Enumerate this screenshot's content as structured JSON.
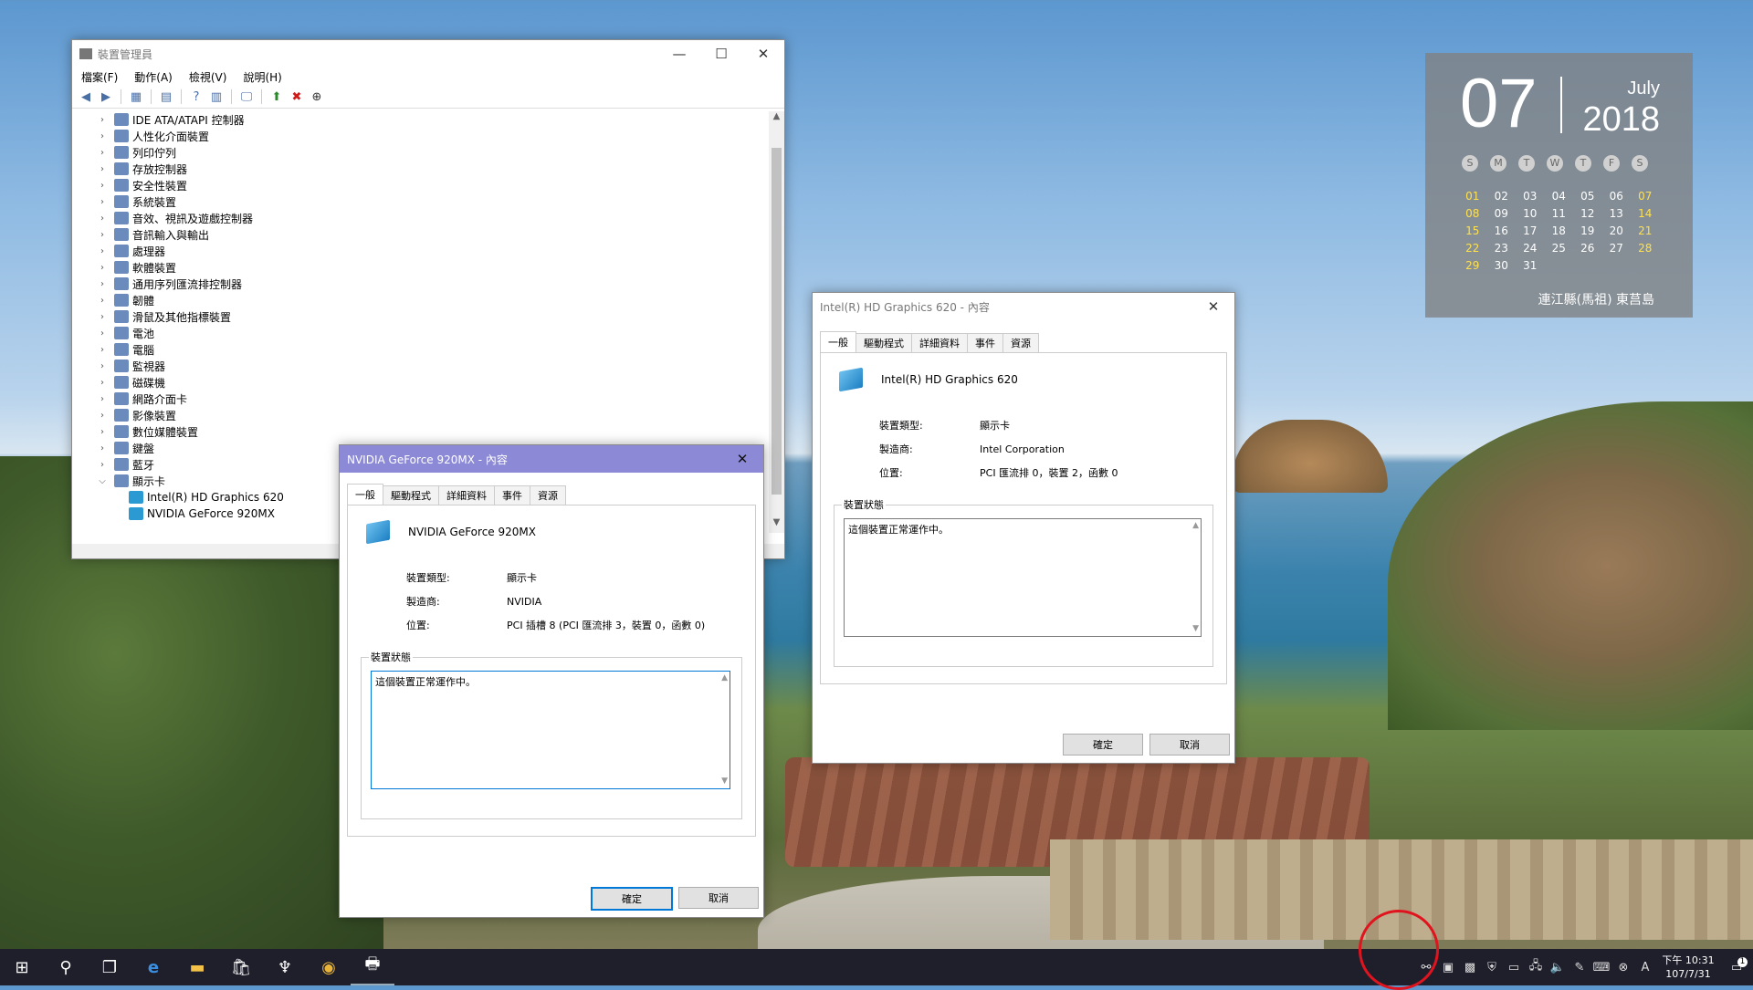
{
  "calendar": {
    "day": "07",
    "month": "July",
    "year": "2018",
    "weekdays": [
      "S",
      "M",
      "T",
      "W",
      "T",
      "F",
      "S"
    ],
    "weeks": [
      [
        "01",
        "02",
        "03",
        "04",
        "05",
        "06",
        "07"
      ],
      [
        "08",
        "09",
        "10",
        "11",
        "12",
        "13",
        "14"
      ],
      [
        "15",
        "16",
        "17",
        "18",
        "19",
        "20",
        "21"
      ],
      [
        "22",
        "23",
        "24",
        "25",
        "26",
        "27",
        "28"
      ],
      [
        "29",
        "30",
        "31",
        "",
        "",
        "",
        ""
      ]
    ],
    "location": "連江縣(馬祖)  東莒島"
  },
  "device_manager": {
    "title": "裝置管理員",
    "menu": [
      "檔案(F)",
      "動作(A)",
      "檢視(V)",
      "說明(H)"
    ],
    "tree": [
      "IDE ATA/ATAPI 控制器",
      "人性化介面裝置",
      "列印佇列",
      "存放控制器",
      "安全性裝置",
      "系統裝置",
      "音效、視訊及遊戲控制器",
      "音訊輸入與輸出",
      "處理器",
      "軟體裝置",
      "通用序列匯流排控制器",
      "韌體",
      "滑鼠及其他指標裝置",
      "電池",
      "電腦",
      "監視器",
      "磁碟機",
      "網路介面卡",
      "影像裝置",
      "數位媒體裝置",
      "鍵盤",
      "藍牙",
      "顯示卡"
    ],
    "display_children": [
      "Intel(R) HD Graphics 620",
      "NVIDIA GeForce 920MX"
    ]
  },
  "nvidia_dialog": {
    "title": "NVIDIA GeForce 920MX - 內容",
    "tabs": [
      "一般",
      "驅動程式",
      "詳細資料",
      "事件",
      "資源"
    ],
    "device_name": "NVIDIA GeForce 920MX",
    "type_label": "裝置類型:",
    "type_value": "顯示卡",
    "mfr_label": "製造商:",
    "mfr_value": "NVIDIA",
    "loc_label": "位置:",
    "loc_value": "PCI 插槽 8 (PCI 匯流排 3，裝置 0，函數 0)",
    "status_group": "裝置狀態",
    "status_text": "這個裝置正常運作中。",
    "ok": "確定",
    "cancel": "取消"
  },
  "intel_dialog": {
    "title": "Intel(R) HD Graphics 620 - 內容",
    "tabs": [
      "一般",
      "驅動程式",
      "詳細資料",
      "事件",
      "資源"
    ],
    "device_name": "Intel(R) HD Graphics 620",
    "type_label": "裝置類型:",
    "type_value": "顯示卡",
    "mfr_label": "製造商:",
    "mfr_value": "Intel Corporation",
    "loc_label": "位置:",
    "loc_value": "PCI 匯流排 0，裝置 2，函數 0",
    "status_group": "裝置狀態",
    "status_text": "這個裝置正常運作中。",
    "ok": "確定",
    "cancel": "取消"
  },
  "taskbar": {
    "clock_time": "下午 10:31",
    "clock_date": "107/7/31",
    "notif_count": "1"
  }
}
